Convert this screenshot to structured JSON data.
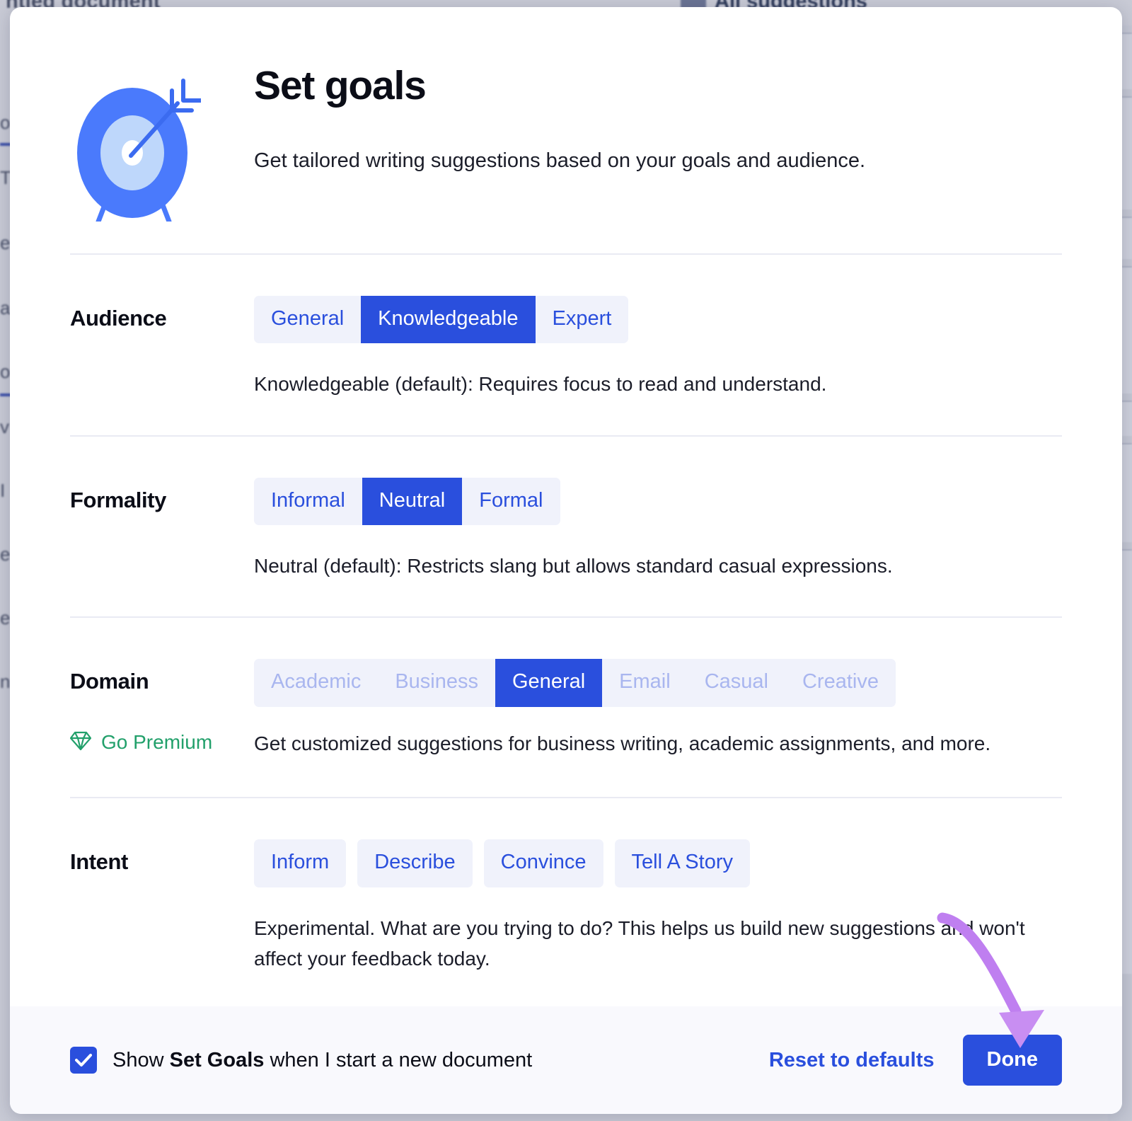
{
  "background": {
    "document_title": "ntled document",
    "suggestions_label": "All suggestions",
    "left_fragments": [
      "o",
      "T",
      "e",
      "a",
      "o",
      "v",
      "I",
      "e",
      "e",
      "n"
    ]
  },
  "modal": {
    "title": "Set goals",
    "subtitle": "Get tailored writing suggestions based on your goals and audience.",
    "icon": "target-arrow-icon",
    "accent_color": "#2a4fdd",
    "pill_bg_color": "#f0f2fb",
    "premium_color": "#22a06b"
  },
  "sections": [
    {
      "key": "audience",
      "label": "Audience",
      "style": "joined",
      "options": [
        {
          "label": "General",
          "state": "default"
        },
        {
          "label": "Knowledgeable",
          "state": "selected"
        },
        {
          "label": "Expert",
          "state": "default"
        }
      ],
      "hint": "Knowledgeable (default): Requires focus to read and understand."
    },
    {
      "key": "formality",
      "label": "Formality",
      "style": "joined",
      "options": [
        {
          "label": "Informal",
          "state": "default"
        },
        {
          "label": "Neutral",
          "state": "selected"
        },
        {
          "label": "Formal",
          "state": "default"
        }
      ],
      "hint": "Neutral (default): Restricts slang but allows standard casual expressions."
    },
    {
      "key": "domain",
      "label": "Domain",
      "style": "joined",
      "options": [
        {
          "label": "Academic",
          "state": "locked"
        },
        {
          "label": "Business",
          "state": "locked"
        },
        {
          "label": "General",
          "state": "selected"
        },
        {
          "label": "Email",
          "state": "locked"
        },
        {
          "label": "Casual",
          "state": "locked"
        },
        {
          "label": "Creative",
          "state": "locked"
        }
      ],
      "premium_label": "Go Premium",
      "premium_icon": "diamond-icon",
      "hint": "Get customized suggestions for business writing, academic assignments, and more."
    },
    {
      "key": "intent",
      "label": "Intent",
      "style": "loose",
      "options": [
        {
          "label": "Inform",
          "state": "default"
        },
        {
          "label": "Describe",
          "state": "default"
        },
        {
          "label": "Convince",
          "state": "default"
        },
        {
          "label": "Tell A Story",
          "state": "default"
        }
      ],
      "hint": "Experimental. What are you trying to do? This helps us build new suggestions and won't affect your feedback today."
    }
  ],
  "footer": {
    "checkbox_checked": true,
    "checkbox_text_before": "Show ",
    "checkbox_text_bold": "Set Goals",
    "checkbox_text_after": " when I start a new document",
    "reset_label": "Reset to defaults",
    "done_label": "Done"
  },
  "annotation": {
    "type": "curved-arrow",
    "color": "#bf7ff0",
    "points_at": "done-button"
  }
}
